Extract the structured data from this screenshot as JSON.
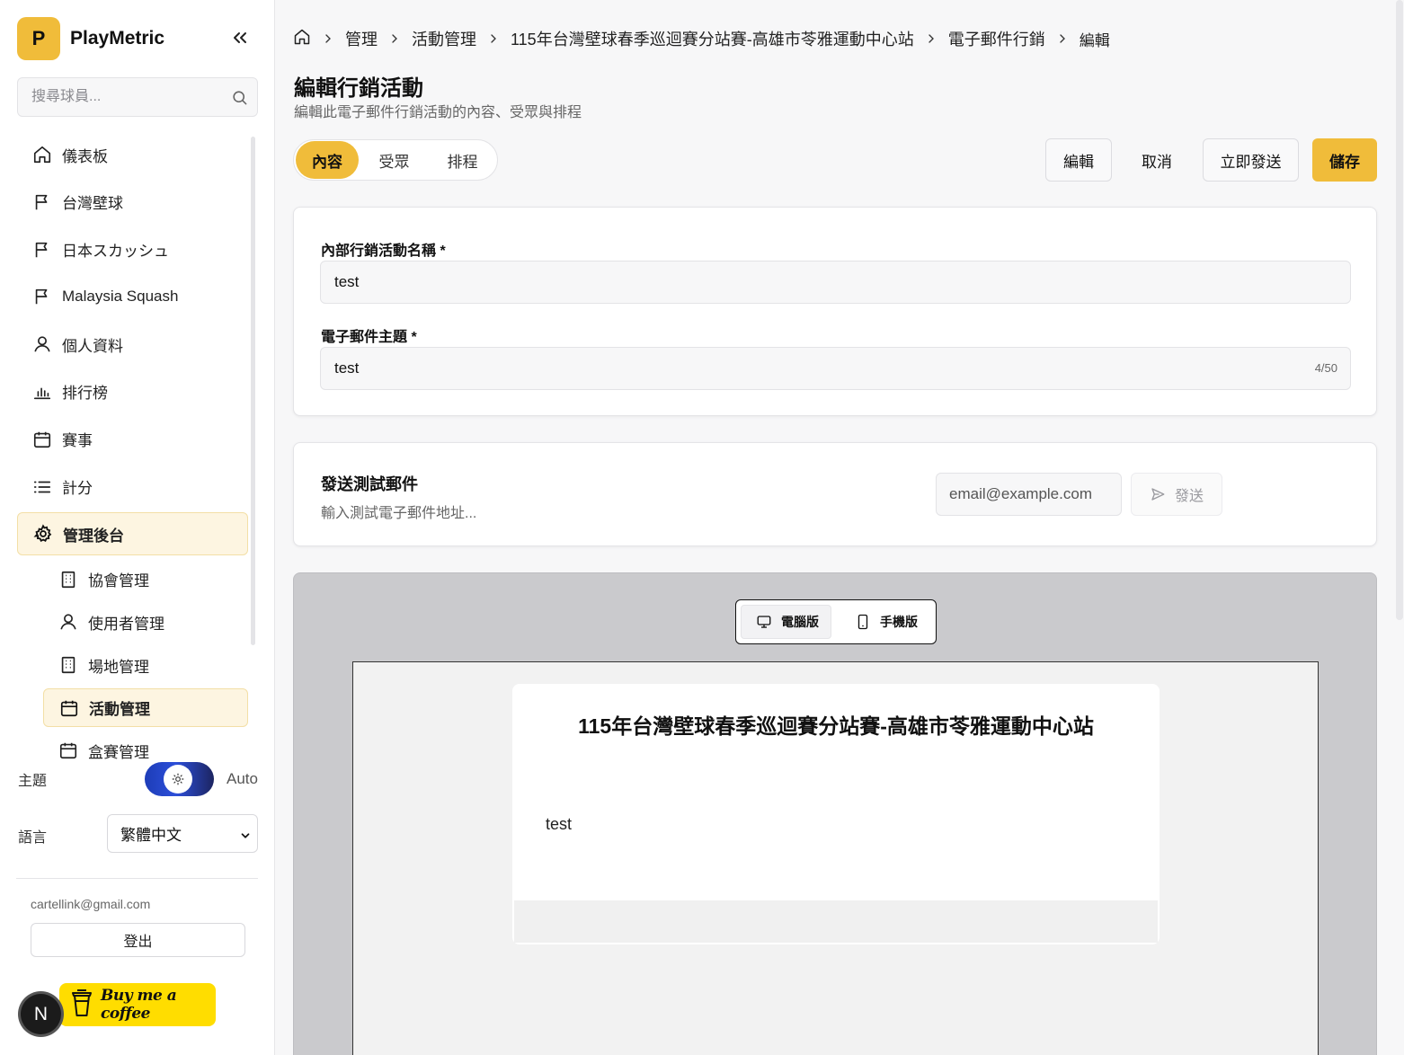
{
  "brand": {
    "logo_letter": "P",
    "name": "PlayMetric"
  },
  "search": {
    "placeholder": "搜尋球員..."
  },
  "sidebar": {
    "items": [
      {
        "label": "儀表板",
        "icon": "home-icon"
      },
      {
        "label": "台灣壁球",
        "icon": "flag-icon"
      },
      {
        "label": "日本スカッシュ",
        "icon": "flag-icon"
      },
      {
        "label": "Malaysia Squash",
        "icon": "flag-icon"
      },
      {
        "label": "個人資料",
        "icon": "user-icon"
      },
      {
        "label": "排行榜",
        "icon": "bar-chart-icon"
      },
      {
        "label": "賽事",
        "icon": "calendar-icon"
      },
      {
        "label": "計分",
        "icon": "list-icon"
      },
      {
        "label": "管理後台",
        "icon": "gear-icon"
      }
    ],
    "sub_items": [
      {
        "label": "協會管理",
        "icon": "building-icon"
      },
      {
        "label": "使用者管理",
        "icon": "user-icon"
      },
      {
        "label": "場地管理",
        "icon": "building-icon"
      },
      {
        "label": "活動管理",
        "icon": "calendar-icon"
      },
      {
        "label": "盒賽管理",
        "icon": "calendar-icon"
      }
    ],
    "theme_label": "主題",
    "theme_value": "Auto",
    "language_label": "語言",
    "language_value": "繁體中文",
    "user_email": "cartellink@gmail.com",
    "logout_label": "登出",
    "n_badge": "N",
    "coffee_label": "Buy me a coffee"
  },
  "breadcrumb": [
    "管理",
    "活動管理",
    "115年台灣壁球春季巡迴賽分站賽-高雄市苓雅運動中心站",
    "電子郵件行銷",
    "編輯"
  ],
  "page": {
    "title": "編輯行銷活動",
    "subtitle": "編輯此電子郵件行銷活動的內容、受眾與排程"
  },
  "tabs": [
    "內容",
    "受眾",
    "排程"
  ],
  "actions": {
    "edit": "編輯",
    "cancel": "取消",
    "send_now": "立即發送",
    "save": "儲存"
  },
  "form": {
    "name_label": "內部行銷活動名稱 *",
    "name_value": "test",
    "subject_label": "電子郵件主題 *",
    "subject_value": "test",
    "subject_count": "4/50"
  },
  "test_email": {
    "title": "發送測試郵件",
    "description": "輸入測試電子郵件地址...",
    "placeholder": "email@example.com",
    "send_label": "發送"
  },
  "preview": {
    "desktop_label": "電腦版",
    "mobile_label": "手機版",
    "email_title": "115年台灣壁球春季巡迴賽分站賽-高雄市苓雅運動中心站",
    "email_body": "test"
  },
  "colors": {
    "accent": "#f0bc3a",
    "accent_light": "#fdf5e1"
  }
}
